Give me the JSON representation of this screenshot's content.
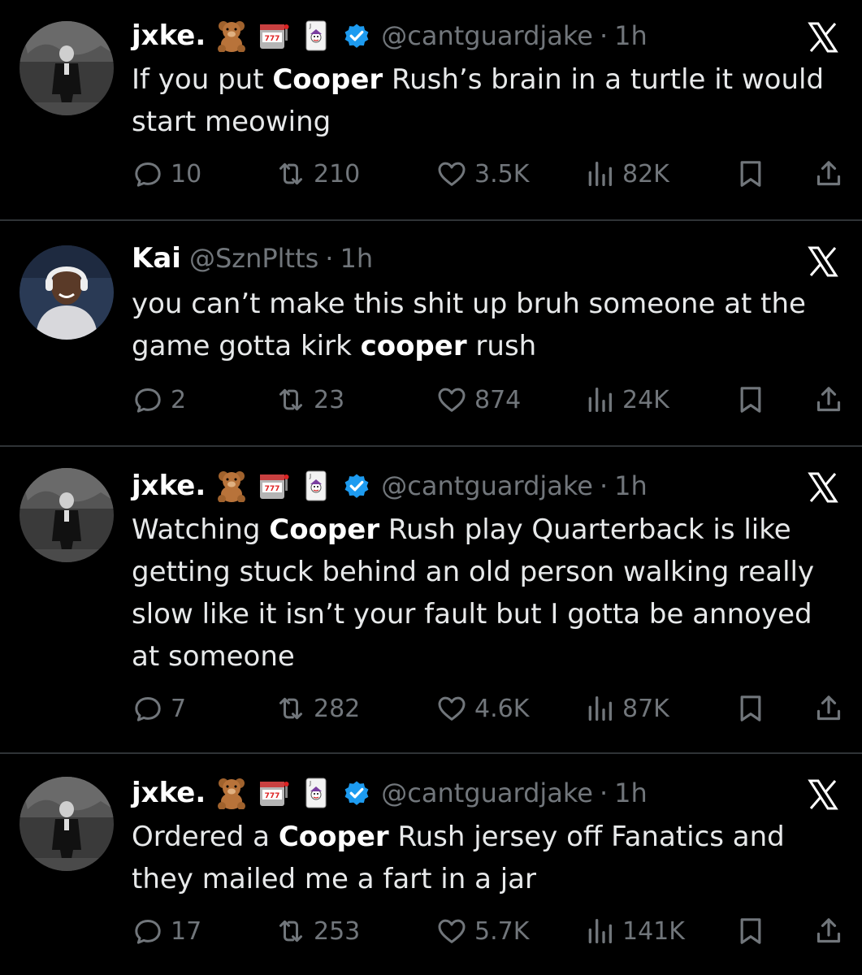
{
  "tweets": [
    {
      "name": "jxke.",
      "emojis": [
        "teddy-bear",
        "slot-machine",
        "joker-card"
      ],
      "verified": true,
      "handle": "@cantguardjake",
      "dot": "·",
      "time": "1h",
      "text_parts": [
        {
          "t": "If you put ",
          "b": false
        },
        {
          "t": "Cooper",
          "b": true
        },
        {
          "t": " Rush’s brain in a turtle it would start meowing",
          "b": false
        }
      ],
      "replies": "10",
      "reposts": "210",
      "likes": "3.5K",
      "views": "82K"
    },
    {
      "name": "Kai",
      "emojis": [],
      "verified": false,
      "handle": "@SznPltts",
      "dot": "·",
      "time": "1h",
      "text_parts": [
        {
          "t": "you can’t make this shit up bruh someone at the game gotta kirk ",
          "b": false
        },
        {
          "t": "cooper",
          "b": true
        },
        {
          "t": " rush",
          "b": false
        }
      ],
      "replies": "2",
      "reposts": "23",
      "likes": "874",
      "views": "24K"
    },
    {
      "name": "jxke.",
      "emojis": [
        "teddy-bear",
        "slot-machine",
        "joker-card"
      ],
      "verified": true,
      "handle": "@cantguardjake",
      "dot": "·",
      "time": "1h",
      "text_parts": [
        {
          "t": "Watching ",
          "b": false
        },
        {
          "t": "Cooper",
          "b": true
        },
        {
          "t": " Rush play Quarterback is like getting stuck behind an old person walking really slow like it isn’t your fault but I gotta be annoyed at someone",
          "b": false
        }
      ],
      "replies": "7",
      "reposts": "282",
      "likes": "4.6K",
      "views": "87K"
    },
    {
      "name": "jxke.",
      "emojis": [
        "teddy-bear",
        "slot-machine",
        "joker-card"
      ],
      "verified": true,
      "handle": "@cantguardjake",
      "dot": "·",
      "time": "1h",
      "text_parts": [
        {
          "t": "Ordered a ",
          "b": false
        },
        {
          "t": "Cooper",
          "b": true
        },
        {
          "t": " Rush jersey off Fanatics and they mailed me a fart in a jar",
          "b": false
        }
      ],
      "replies": "17",
      "reposts": "253",
      "likes": "5.7K",
      "views": "141K"
    }
  ],
  "icons": {
    "reply": "reply-icon",
    "repost": "repost-icon",
    "like": "heart-icon",
    "views": "views-icon",
    "bookmark": "bookmark-icon",
    "share": "share-icon",
    "platform": "x-logo-icon"
  },
  "colors": {
    "background": "#000000",
    "text": "#e7e9ea",
    "muted": "#71767b",
    "verified": "#1d9bf0",
    "divider": "#2f3336"
  }
}
